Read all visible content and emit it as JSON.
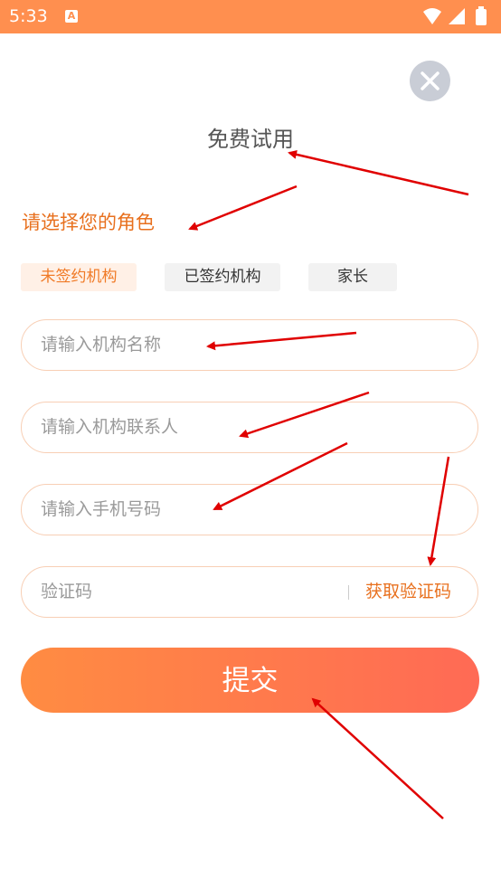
{
  "status_bar": {
    "time": "5:33",
    "notification_icon": "A",
    "icons": [
      "wifi-icon",
      "signal-icon",
      "battery-icon"
    ]
  },
  "dialog": {
    "title": "免费试用",
    "close_icon": "close-icon",
    "role_heading": "请选择您的角色",
    "roles": [
      {
        "label": "未签约机构",
        "selected": true
      },
      {
        "label": "已签约机构",
        "selected": false
      },
      {
        "label": "家长",
        "selected": false
      }
    ],
    "fields": {
      "org_name": {
        "value": "",
        "placeholder": "请输入机构名称"
      },
      "contact": {
        "value": "",
        "placeholder": "请输入机构联系人"
      },
      "phone": {
        "value": "",
        "placeholder": "请输入手机号码"
      },
      "code": {
        "value": "",
        "placeholder": "验证码"
      }
    },
    "get_code_label": "获取验证码",
    "submit_label": "提交"
  },
  "colors": {
    "status_bar": "#ff8f4f",
    "accent": "#e8701e",
    "field_border": "#f8cfb5",
    "button_start": "#ff8c42",
    "button_end": "#ff6a55",
    "annotation_arrow": "#e00000"
  }
}
